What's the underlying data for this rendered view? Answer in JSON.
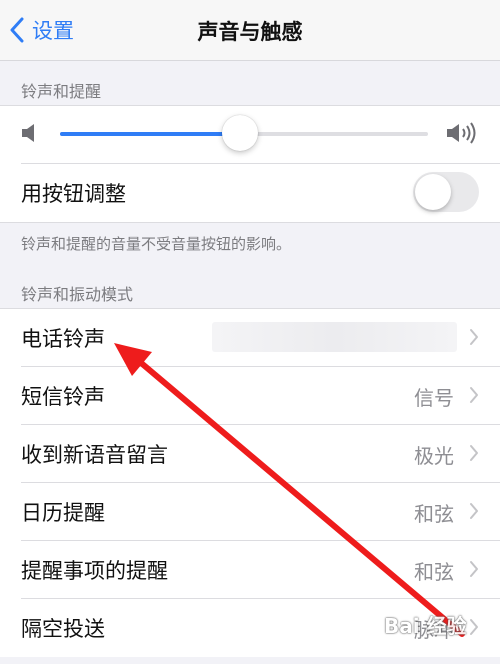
{
  "navbar": {
    "back_label": "设置",
    "title": "声音与触感"
  },
  "ringtone_section": {
    "header": "铃声和提醒",
    "volume_level": 0.49,
    "button_adjust_label": "用按钮调整",
    "button_adjust_on": false,
    "footer": "铃声和提醒的音量不受音量按钮的影响。"
  },
  "pattern_section": {
    "header": "铃声和振动模式",
    "rows": [
      {
        "label": "电话铃声",
        "value": ""
      },
      {
        "label": "短信铃声",
        "value": "信号"
      },
      {
        "label": "收到新语音留言",
        "value": "极光"
      },
      {
        "label": "日历提醒",
        "value": "和弦"
      },
      {
        "label": "提醒事项的提醒",
        "value": "和弦"
      },
      {
        "label": "隔空投送",
        "value": "脉冲"
      }
    ]
  },
  "colors": {
    "accent": "#2f7df6",
    "arrow": "#ee1c1c"
  },
  "icons": {
    "volume_low": "speaker-low-icon",
    "volume_high": "speaker-high-icon"
  }
}
